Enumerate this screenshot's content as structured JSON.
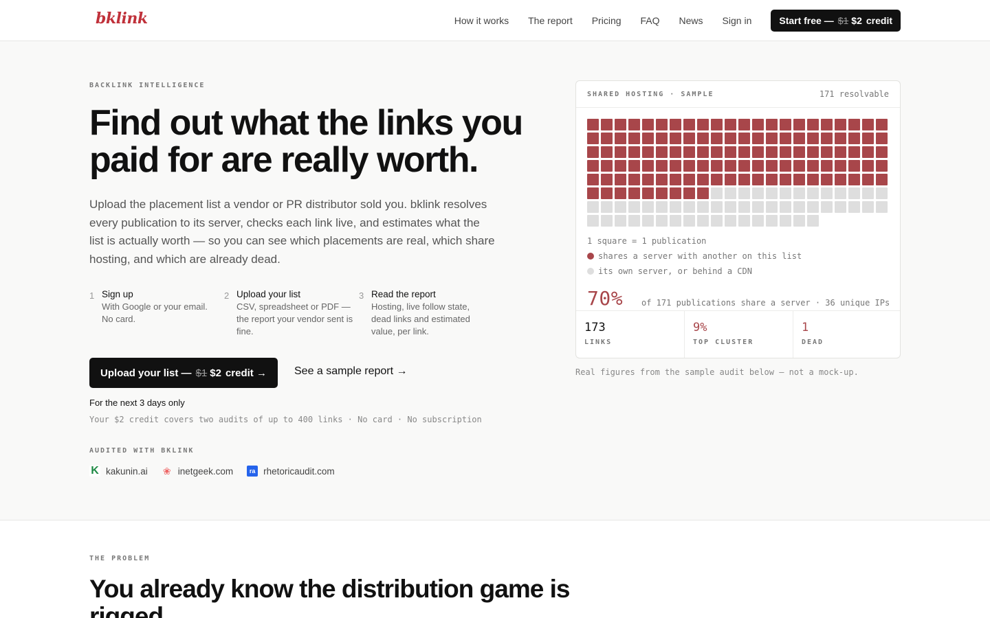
{
  "nav": {
    "logo": "bklink",
    "links": [
      "How it works",
      "The report",
      "Pricing",
      "FAQ",
      "News",
      "Sign in"
    ],
    "cta": {
      "label": "Start free —",
      "old_price": "$1",
      "new_price": "$2",
      "suffix": "credit"
    }
  },
  "hero": {
    "eyebrow": "BACKLINK INTELLIGENCE",
    "title": "Find out what the links you paid for are really worth.",
    "description": "Upload the placement list a vendor or PR distributor sold you. bklink resolves every publication to its server, checks each link live, and estimates what the list is actually worth — so you can see which placements are real, which share hosting, and which are already dead.",
    "steps": [
      {
        "num": "1",
        "title": "Sign up",
        "text": "With Google or your email. No card."
      },
      {
        "num": "2",
        "title": "Upload your list",
        "text": "CSV, spreadsheet or PDF — the report your vendor sent is fine."
      },
      {
        "num": "3",
        "title": "Read the report",
        "text": "Hosting, live follow state, dead links and estimated value, per link."
      }
    ],
    "primary_button": {
      "label": "Upload your list —",
      "old_price": "$1",
      "new_price": "$2",
      "suffix": "credit →"
    },
    "secondary_link": "See a sample report →",
    "offer": "For the next 3 days only",
    "fineprint": "Your $2 credit covers two audits of up to 400 links · No card · No subscription",
    "audited_label": "AUDITED WITH BKLINK",
    "clients": [
      {
        "name": "kakunin.ai",
        "icon": "k-logo-icon"
      },
      {
        "name": "inetgeek.com",
        "icon": "flame-logo-icon"
      },
      {
        "name": "rhetoricaudit.com",
        "icon": "ra-logo-icon"
      }
    ]
  },
  "card": {
    "header_left": "SHARED HOSTING · SAMPLE",
    "header_right": "171 resolvable",
    "grid": {
      "total": 171,
      "shared": 119,
      "shared_color": "#a8464a",
      "own_color": "#dedede"
    },
    "legend_scale": "1 square = 1 publication",
    "legend_shared": "shares a server with another on this list",
    "legend_own": "its own server, or behind a CDN",
    "big_pct": "70%",
    "pct_note": "of 171 publications share a server · 36 unique IPs",
    "stats": [
      {
        "value": "173",
        "label": "LINKS",
        "color": "#111111"
      },
      {
        "value": "9%",
        "label": "TOP CLUSTER",
        "color": "#a8464a"
      },
      {
        "value": "1",
        "label": "DEAD",
        "color": "#a8464a"
      }
    ],
    "caption": "Real figures from the sample audit below — not a mock-up."
  },
  "section2": {
    "eyebrow": "THE PROBLEM",
    "title": "You already know the distribution game is rigged."
  }
}
